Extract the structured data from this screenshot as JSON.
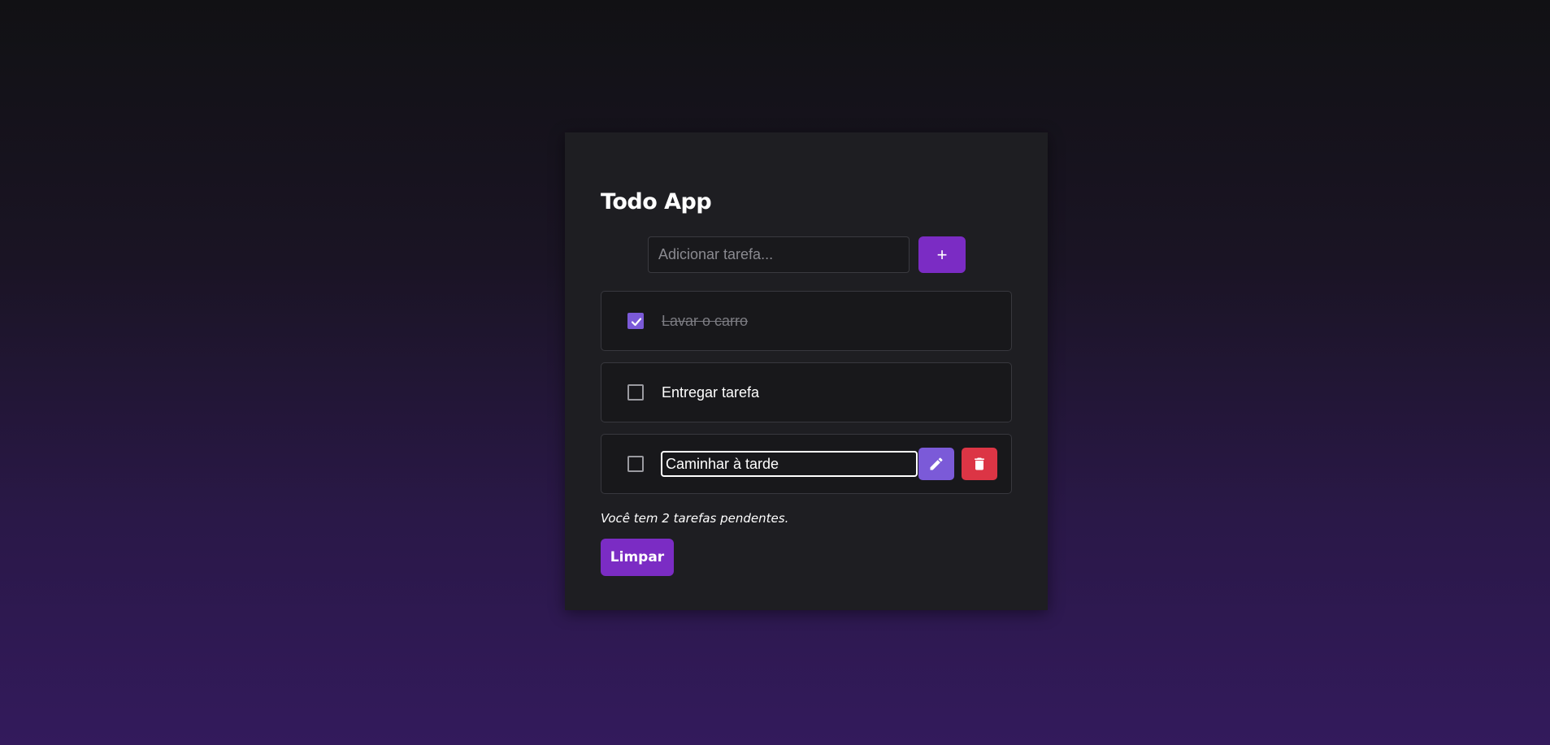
{
  "app": {
    "title": "Todo App"
  },
  "new_task": {
    "placeholder": "Adicionar tarefa...",
    "value": "",
    "add_icon": "plus-icon",
    "add_label": "+"
  },
  "tasks": [
    {
      "label": "Lavar o carro",
      "completed": true,
      "editing": false
    },
    {
      "label": "Entregar tarefa",
      "completed": false,
      "editing": false
    },
    {
      "label": "Caminhar à tarde",
      "completed": false,
      "editing": true,
      "edit_value": "Caminhar à tarde"
    }
  ],
  "task_actions": {
    "edit_icon": "pencil-icon",
    "delete_icon": "trash-icon"
  },
  "footer": {
    "pending_text": "Você tem 2 tarefas pendentes.",
    "clear_label": "Limpar"
  },
  "colors": {
    "accent": "#7b2cc4",
    "checkbox_accent": "#7b5ad8",
    "danger": "#dc3545",
    "card_bg": "#1e1e22",
    "task_bg": "#18181b"
  }
}
